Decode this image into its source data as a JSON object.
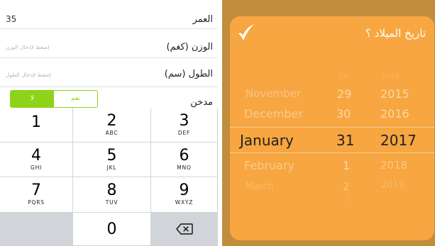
{
  "form": {
    "age_label": "العمر",
    "age_value": "35",
    "weight_label": "الوزن (كغم)",
    "weight_placeholder": "إضغط لإدخال الوزن",
    "height_label": "الطول (سم)",
    "height_placeholder": "إضغط لإدخال الطول",
    "smoker_label": "مدخن",
    "smoker_yes": "نعم",
    "smoker_no": "لا",
    "smoker_selected": "لا"
  },
  "keypad": {
    "keys": [
      {
        "digit": "1",
        "letters": ""
      },
      {
        "digit": "2",
        "letters": "ABC"
      },
      {
        "digit": "3",
        "letters": "DEF"
      },
      {
        "digit": "4",
        "letters": "GHI"
      },
      {
        "digit": "5",
        "letters": "JKL"
      },
      {
        "digit": "6",
        "letters": "MNO"
      },
      {
        "digit": "7",
        "letters": "PQRS"
      },
      {
        "digit": "8",
        "letters": "TUV"
      },
      {
        "digit": "9",
        "letters": "WXYZ"
      },
      {
        "digit": "0",
        "letters": ""
      }
    ],
    "delete_icon": "backspace-icon"
  },
  "date_picker": {
    "title": "تاريخ الميلاد ؟",
    "confirm_icon": "checkmark-icon",
    "months": [
      "November",
      "December",
      "January",
      "February",
      "March"
    ],
    "days": [
      "28",
      "29",
      "30",
      "31",
      "1",
      "2",
      "3"
    ],
    "years": [
      "2014",
      "2015",
      "2016",
      "2017",
      "2018",
      "2019"
    ],
    "selected_month": "January",
    "selected_day": "31",
    "selected_year": "2017"
  },
  "colors": {
    "accent_green": "#8dd319",
    "picker_orange": "#f7a641",
    "backdrop_brown": "#c28c3d"
  }
}
